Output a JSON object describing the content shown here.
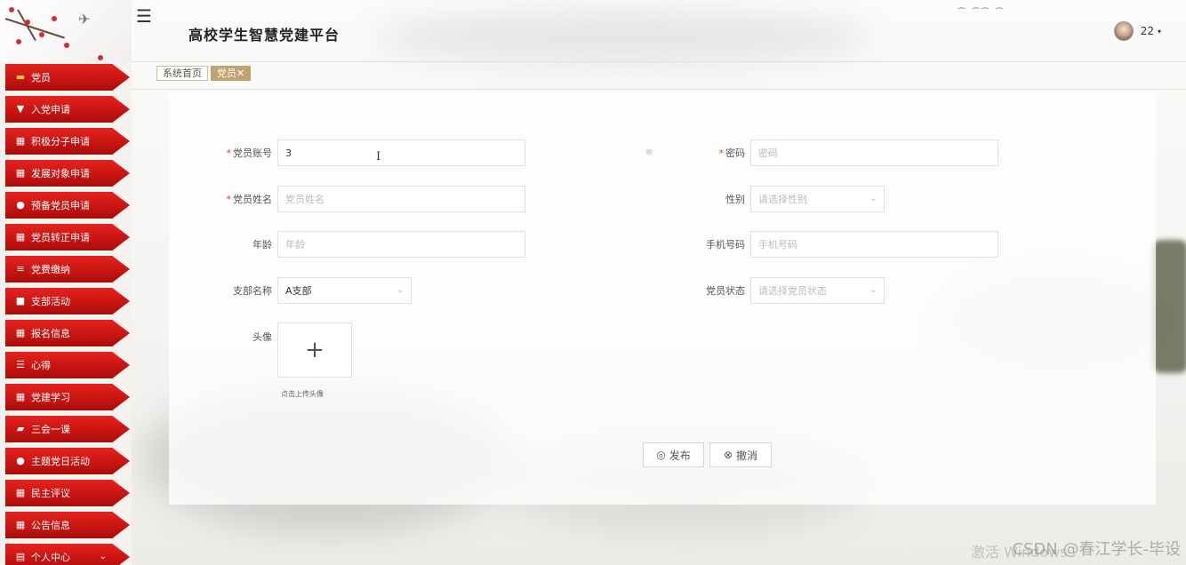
{
  "header": {
    "title": "高校学生智慧党建平台",
    "user_name": "22",
    "caret": "▾"
  },
  "sidebar": {
    "items": [
      {
        "label": "党员",
        "icon": "monitor-icon",
        "glyph": "▬",
        "active": true
      },
      {
        "label": "入党申请",
        "icon": "podium-icon",
        "glyph": "▼"
      },
      {
        "label": "积极分子申请",
        "icon": "grid-icon",
        "glyph": "▦"
      },
      {
        "label": "发展对象申请",
        "icon": "table-icon",
        "glyph": "▦"
      },
      {
        "label": "预备党员申请",
        "icon": "user-icon",
        "glyph": "●"
      },
      {
        "label": "党员转正申请",
        "icon": "grid-icon",
        "glyph": "▦"
      },
      {
        "label": "党费缴纳",
        "icon": "list-icon",
        "glyph": "≡"
      },
      {
        "label": "支部活动",
        "icon": "video-icon",
        "glyph": "■"
      },
      {
        "label": "报名信息",
        "icon": "grid-icon",
        "glyph": "▦"
      },
      {
        "label": "心得",
        "icon": "sliders-icon",
        "glyph": "☰"
      },
      {
        "label": "党建学习",
        "icon": "grid-icon",
        "glyph": "▦"
      },
      {
        "label": "三会一课",
        "icon": "folder-icon",
        "glyph": "▰"
      },
      {
        "label": "主题党日活动",
        "icon": "user-icon",
        "glyph": "●"
      },
      {
        "label": "民主评议",
        "icon": "grid-icon",
        "glyph": "▦"
      },
      {
        "label": "公告信息",
        "icon": "grid-icon",
        "glyph": "▦"
      },
      {
        "label": "个人中心",
        "icon": "form-icon",
        "glyph": "▤",
        "chevron": "⌄"
      }
    ]
  },
  "tabs": [
    {
      "label": "系统首页",
      "active": false
    },
    {
      "label": "党员✕",
      "active": true
    }
  ],
  "form": {
    "account": {
      "label": "党员账号",
      "value": "3"
    },
    "password": {
      "label": "密码",
      "placeholder": "密码"
    },
    "name": {
      "label": "党员姓名",
      "placeholder": "党员姓名"
    },
    "gender": {
      "label": "性别",
      "placeholder": "请选择性别"
    },
    "age": {
      "label": "年龄",
      "placeholder": "年龄"
    },
    "phone": {
      "label": "手机号码",
      "placeholder": "手机号码"
    },
    "branch": {
      "label": "支部名称",
      "value": "A支部"
    },
    "status": {
      "label": "党员状态",
      "placeholder": "请选择党员状态"
    },
    "avatar": {
      "label": "头像",
      "tip": "点击上传头像",
      "plus": "+"
    },
    "required_mark": "*"
  },
  "buttons": {
    "publish": "发布",
    "cancel": "撤消"
  },
  "overlay": {
    "watermark": "CSDN @春江学长-毕设",
    "activate": "激活 Windows"
  },
  "colors": {
    "menu_red": "#c91512",
    "tag_gold": "#bfa372",
    "required": "#ee3333"
  }
}
